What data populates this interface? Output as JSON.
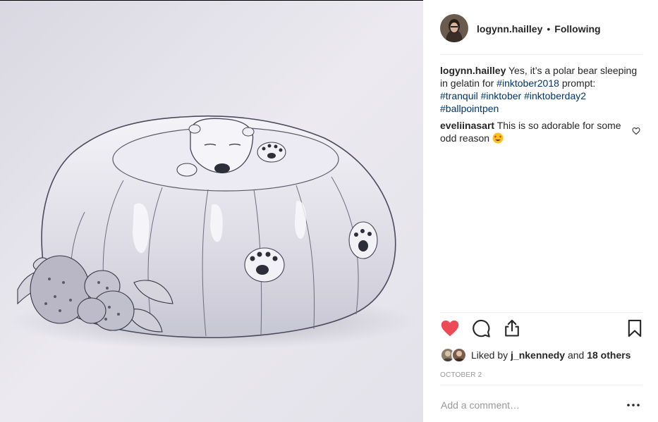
{
  "post": {
    "author": "logynn.hailley",
    "separator": "•",
    "follow_status": "Following",
    "caption": {
      "username": "logynn.hailley",
      "text": "Yes, it’s a polar bear sleeping in gelatin for",
      "tag1": "#inktober2018",
      "text2": "prompt:",
      "tags": [
        "#tranquil",
        "#inktober",
        "#inktoberday2",
        "#ballpointpen"
      ]
    },
    "comment": {
      "username": "eveliinasart",
      "text": "This is so adorable for some odd reason",
      "emoji": "heart-eyes-emoji"
    },
    "actions": {
      "like_icon": "heart-filled-icon",
      "comment_icon": "comment-icon",
      "share_icon": "share-icon",
      "save_icon": "bookmark-icon",
      "like_color": "#ed4956"
    },
    "likes": {
      "prefix": "Liked by",
      "user": "j_nkennedy",
      "conjunction": "and",
      "others": "18 others"
    },
    "date": "OCTOBER 2",
    "add_comment_placeholder": "Add a comment…",
    "more_icon": "ellipsis-icon"
  }
}
